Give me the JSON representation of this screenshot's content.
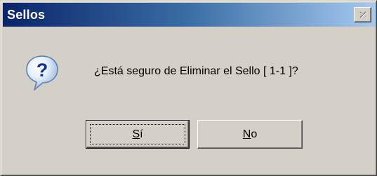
{
  "window": {
    "title": "Sellos",
    "close_icon": "close-icon"
  },
  "dialog": {
    "icon": "question-icon",
    "message": "¿Está seguro de Eliminar el Sello [ 1-1 ]?"
  },
  "buttons": {
    "yes_label": "Sí",
    "no_label": "No"
  },
  "colors": {
    "titlebar_start": "#0a246a",
    "titlebar_end": "#a6caf0",
    "dialog_face": "#d4d0c8"
  }
}
